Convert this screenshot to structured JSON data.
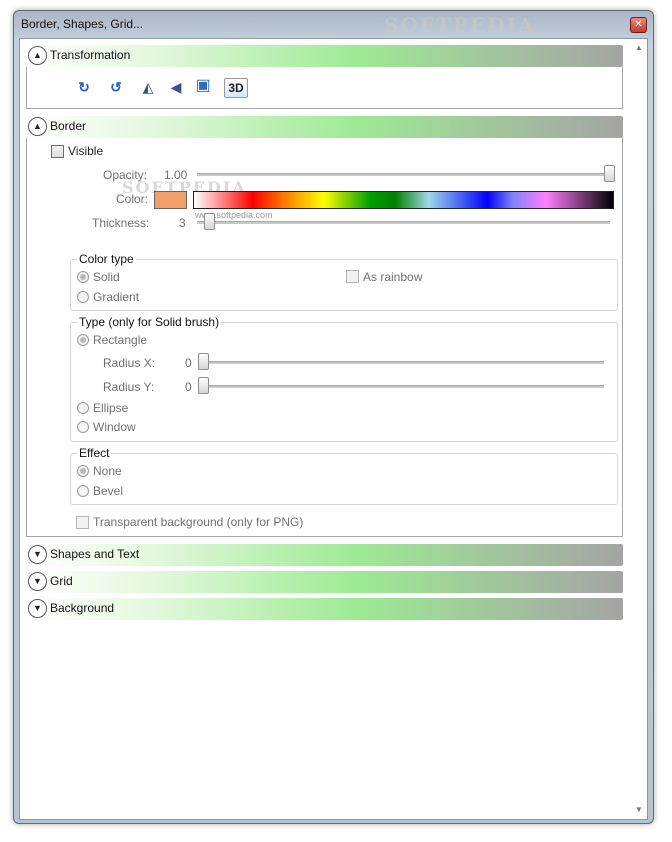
{
  "window": {
    "title": "Border, Shapes, Grid...",
    "close_glyph": "✕"
  },
  "watermark": {
    "top": "SOFTPEDIA",
    "mid": "SOFTPEDIA",
    "url": "www.softpedia.com"
  },
  "scroll": {
    "up_glyph": "▲",
    "down_glyph": "▼"
  },
  "sections": {
    "transformation": {
      "label": "Transformation",
      "glyph": "▲"
    },
    "border": {
      "label": "Border",
      "glyph": "▲"
    },
    "shapes_text": {
      "label": "Shapes and Text",
      "glyph": "▼"
    },
    "grid": {
      "label": "Grid",
      "glyph": "▼"
    },
    "background": {
      "label": "Background",
      "glyph": "▼"
    }
  },
  "toolbar": {
    "rotate_cw": "↻",
    "rotate_ccw": "↺",
    "flip_h": "◭",
    "flip_v": "◀",
    "image": "▣",
    "threed": "3D"
  },
  "border": {
    "visible_label": "Visible",
    "opacity_label": "Opacity:",
    "opacity_value": "1.00",
    "opacity_fraction": 1.0,
    "color_label": "Color:",
    "color_swatch": "#f0a068",
    "thickness_label": "Thickness:",
    "thickness_value": "3",
    "color_type": {
      "title": "Color type",
      "solid": "Solid",
      "gradient": "Gradient",
      "as_rainbow": "As rainbow"
    },
    "type": {
      "title": "Type (only for Solid brush)",
      "rectangle": "Rectangle",
      "radius_x_label": "Radius X:",
      "radius_x_value": "0",
      "radius_y_label": "Radius Y:",
      "radius_y_value": "0",
      "ellipse": "Ellipse",
      "window": "Window"
    },
    "effect": {
      "title": "Effect",
      "none": "None",
      "bevel": "Bevel"
    },
    "transparent_bg": "Transparent background (only for PNG)"
  }
}
